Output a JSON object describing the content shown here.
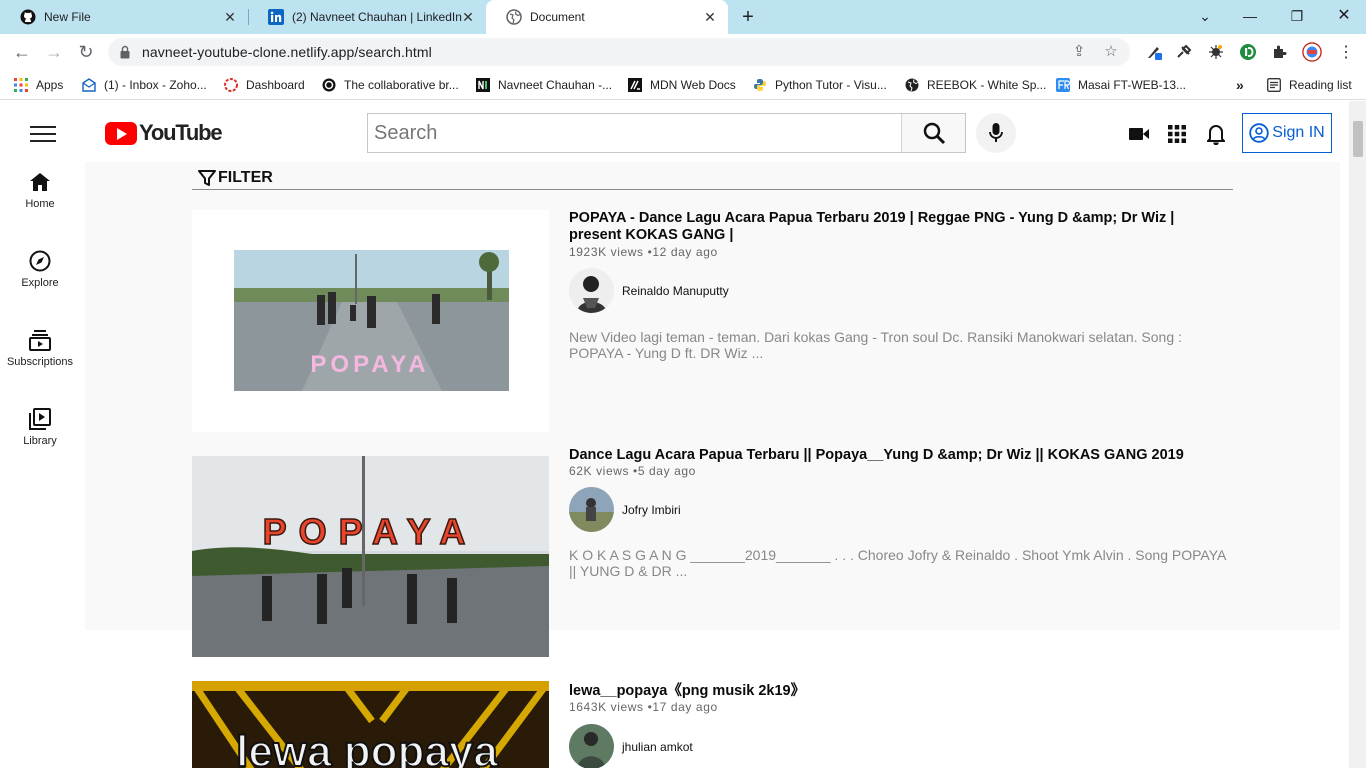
{
  "browser": {
    "tabs": [
      {
        "title": "New File",
        "active": false
      },
      {
        "title": "(2) Navneet Chauhan | LinkedIn",
        "active": false
      },
      {
        "title": "Document",
        "active": true
      }
    ],
    "new_tab": "+",
    "url": "navneet-youtube-clone.netlify.app/search.html",
    "bookmarks": [
      {
        "label": "Apps",
        "icon": "apps-grid-icon"
      },
      {
        "label": "(1) - Inbox - Zoho...",
        "icon": "zoho-mail-icon"
      },
      {
        "label": "Dashboard",
        "icon": "dashboard-icon"
      },
      {
        "label": "The collaborative br...",
        "icon": "collab-icon"
      },
      {
        "label": "Navneet Chauhan -...",
        "icon": "n-logo-icon"
      },
      {
        "label": "MDN Web Docs",
        "icon": "mdn-icon"
      },
      {
        "label": "Python Tutor - Visu...",
        "icon": "python-icon"
      },
      {
        "label": "REEBOK - White Sp...",
        "icon": "globe-icon"
      },
      {
        "label": "Masai FT-WEB-13...",
        "icon": "masai-icon"
      }
    ],
    "more_bookmarks": "»",
    "reading_list": "Reading list"
  },
  "header": {
    "logo_text": "YouTube",
    "search_placeholder": "Search",
    "sign_in_label": "Sign IN"
  },
  "sidebar": {
    "items": [
      {
        "label": "Home",
        "icon": "home-icon"
      },
      {
        "label": "Explore",
        "icon": "compass-icon"
      },
      {
        "label": "Subscriptions",
        "icon": "subscriptions-icon"
      },
      {
        "label": "Library",
        "icon": "library-icon"
      }
    ]
  },
  "filter_label": "FILTER",
  "videos": [
    {
      "title": "POPAYA - Dance Lagu Acara Papua Terbaru 2019 | Reggae PNG - Yung D &amp; Dr Wiz | present KOKAS GANG |",
      "meta": "1923K views •12 day ago",
      "channel": "Reinaldo Manuputty",
      "description": "New Video lagi teman - teman. Dari kokas Gang - Tron soul Dc. Ransiki Manokwari selatan. Song : POPAYA - Yung D ft. DR Wiz ...",
      "thumb_text": "POPAYA"
    },
    {
      "title": "Dance Lagu Acara Papua Terbaru || Popaya__Yung D &amp; Dr Wiz || KOKAS GANG 2019",
      "meta": "62K views •5 day ago",
      "channel": "Jofry Imbiri",
      "description": "K O K A S G A N G _______2019_______ . . . Choreo Jofry & Reinaldo . Shoot Ymk Alvin . Song POPAYA || YUNG D & DR ...",
      "thumb_text": "POPAYA"
    },
    {
      "title": "lewa__popaya《png musik 2k19》",
      "meta": "1643K views •17 day ago",
      "channel": "jhulian amkot",
      "description": "",
      "thumb_text": "lewa popaya"
    }
  ]
}
